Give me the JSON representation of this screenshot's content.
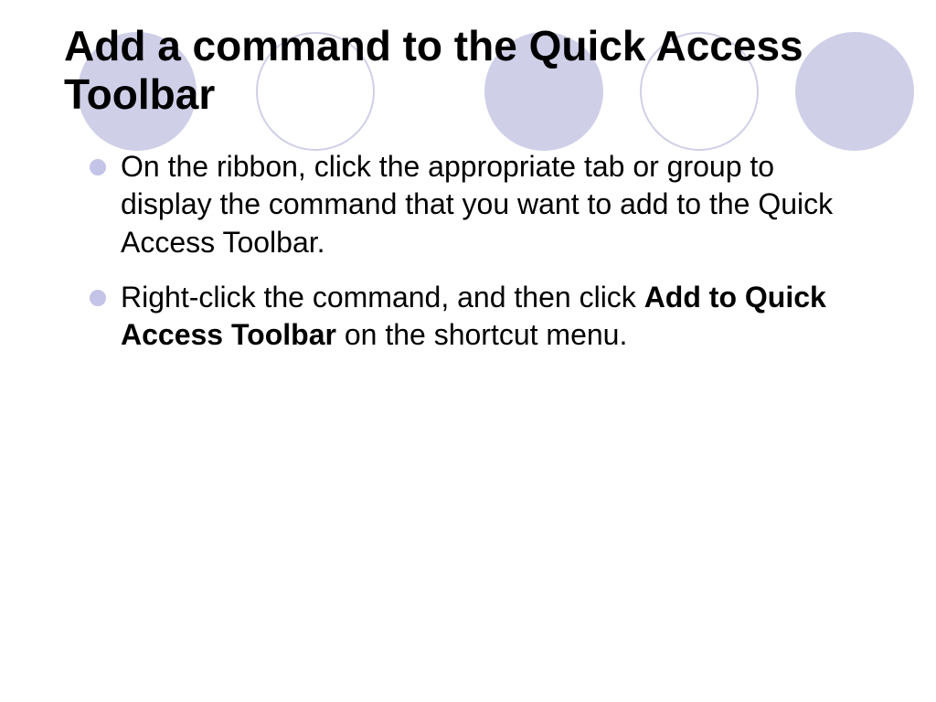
{
  "slide": {
    "title": "Add a command to the Quick Access Toolbar",
    "bullets": [
      {
        "pre": "On the ribbon, click the appropriate tab or group to display the command that you want to add to the Quick Access Toolbar.",
        "bold": "",
        "post": ""
      },
      {
        "pre": "Right-click the command, and then click ",
        "bold": "Add to Quick Access Toolbar",
        "post": " on the shortcut menu."
      }
    ]
  }
}
